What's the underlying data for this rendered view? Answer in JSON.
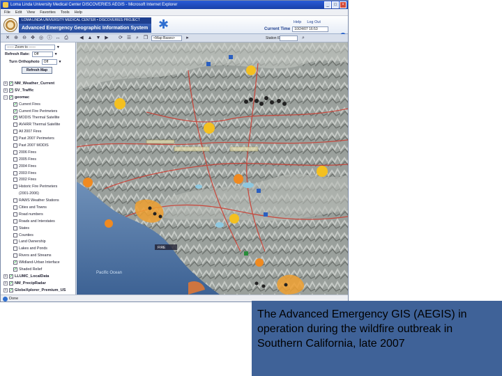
{
  "window": {
    "title": "Loma Linda University Medical Center DISCOVERIES AEGIS - Microsoft Internet Explorer",
    "controls": [
      "_",
      "□",
      "×"
    ]
  },
  "menu": [
    "File",
    "Edit",
    "View",
    "Favorites",
    "Tools",
    "Help"
  ],
  "banner": {
    "org": "LOMA LINDA UNIVERSITY MEDICAL CENTER • DISCOVERIES PROJECT",
    "app_title": "Advanced Emergency Geographic Information System",
    "links": {
      "help": "Help",
      "logout": "Log Out"
    },
    "current_time_label": "Current Time",
    "current_time_value": "10/24/07 16:53"
  },
  "toolbar": {
    "map_base": "<Map Bases>",
    "station_label": "Station ID:"
  },
  "controls": {
    "zoom_value": "------ Zoom to ------",
    "refresh_rate_label": "Refresh Rate:",
    "refresh_rate_value": "Off",
    "orthophoto_label": "Turn Orthophoto",
    "orthophoto_value": "Off",
    "refresh_button": "Refresh Map"
  },
  "layers": [
    {
      "label": "NM_Weather_Current",
      "level": 0,
      "expander": "+",
      "checked": true
    },
    {
      "label": "SV_Traffic",
      "level": 0,
      "expander": "+",
      "checked": true
    },
    {
      "label": "geomac",
      "level": 0,
      "expander": "−",
      "checked": true
    },
    {
      "label": "Current Fires",
      "level": 1,
      "checked": true
    },
    {
      "label": "Current Fire Perimeters",
      "level": 1,
      "checked": true
    },
    {
      "label": "MODIS Thermal Satellite",
      "level": 1,
      "checked": true
    },
    {
      "label": "AVHRR Thermal Satellite",
      "level": 1,
      "checked": false
    },
    {
      "label": "All 2007 Fires",
      "level": 1,
      "checked": false
    },
    {
      "label": "Past 2007 Perimeters",
      "level": 1,
      "checked": false
    },
    {
      "label": "Past 2007 MODIS",
      "level": 1,
      "checked": false
    },
    {
      "label": "2006 Fires",
      "level": 1,
      "checked": false
    },
    {
      "label": "2005 Fires",
      "level": 1,
      "checked": false
    },
    {
      "label": "2004 Fires",
      "level": 1,
      "checked": false
    },
    {
      "label": "2003 Fires",
      "level": 1,
      "checked": false
    },
    {
      "label": "2002 Fires",
      "level": 1,
      "checked": false
    },
    {
      "label": "Historic Fire Perimeters",
      "level": 1,
      "checked": false
    },
    {
      "label": "(2001-2006)",
      "level": 2,
      "checkbox": false
    },
    {
      "label": "RAWS Weather Stations",
      "level": 1,
      "checked": false
    },
    {
      "label": "Cities and Towns",
      "level": 1,
      "checked": false
    },
    {
      "label": "Road numbers",
      "level": 1,
      "checked": false
    },
    {
      "label": "Roads and Interstates",
      "level": 1,
      "checked": false
    },
    {
      "label": "States",
      "level": 1,
      "checked": false
    },
    {
      "label": "Counties",
      "level": 1,
      "checked": false
    },
    {
      "label": "Land Ownership",
      "level": 1,
      "checked": false
    },
    {
      "label": "Lakes and Ponds",
      "level": 1,
      "checked": false
    },
    {
      "label": "Rivers and Streams",
      "level": 1,
      "checked": false
    },
    {
      "label": "Wildland-Urban Interface",
      "level": 1,
      "checked": true
    },
    {
      "label": "Shaded Relief",
      "level": 1,
      "checked": true
    },
    {
      "label": "LLUMC_LocalData",
      "level": 0,
      "expander": "+",
      "checked": true
    },
    {
      "label": "NM_PrecipRadar",
      "level": 0,
      "expander": "+",
      "checked": true
    },
    {
      "label": "GlobeXplorer_Premium_US",
      "level": 0,
      "expander": "+",
      "checked": true
    }
  ],
  "map": {
    "ocean_label": "Pacific Ocean",
    "fire_label": "FIRE"
  },
  "status": {
    "text": "Done"
  },
  "caption": "The Advanced Emergency GIS (AEGIS) in operation during the wildfire outbreak in Southern California, late 2007"
}
